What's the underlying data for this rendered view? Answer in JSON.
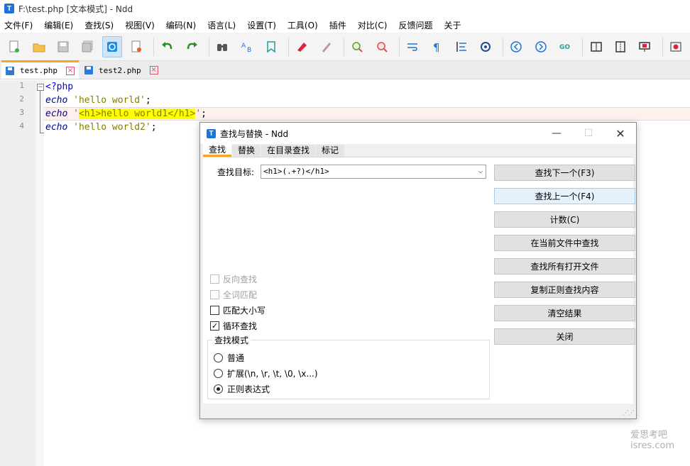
{
  "window": {
    "title": "F:\\test.php [文本模式] - Ndd",
    "icon": "T"
  },
  "menu": [
    "文件(F)",
    "编辑(E)",
    "查找(S)",
    "视图(V)",
    "编码(N)",
    "语言(L)",
    "设置(T)",
    "工具(O)",
    "插件",
    "对比(C)",
    "反馈问题",
    "关于"
  ],
  "tabs": [
    {
      "label": "test.php",
      "active": true
    },
    {
      "label": "test2.php",
      "active": false
    }
  ],
  "editor": {
    "line_numbers": [
      "1",
      "2",
      "3",
      "4"
    ],
    "line1": {
      "open": "<?php"
    },
    "line2": {
      "kw": "echo",
      "sp": " ",
      "str": "'hello world'",
      "end": ";"
    },
    "line3": {
      "kw": "echo",
      "sp": " ",
      "q1": "'",
      "hl": "<h1>hello world1</h1>",
      "q2": "'",
      "end": ";"
    },
    "line4": {
      "kw": "echo",
      "sp": " ",
      "str": "'hello world2'",
      "end": ";"
    }
  },
  "dialog": {
    "title": "查找与替换 - Ndd",
    "tabs": [
      "查找",
      "替换",
      "在目录查找",
      "标记"
    ],
    "target_label": "查找目标:",
    "target_value": "<h1>(.+?)</h1>",
    "options": {
      "reverse": {
        "label": "反向查找",
        "checked": false,
        "enabled": false
      },
      "whole_word": {
        "label": "全词匹配",
        "checked": false,
        "enabled": false
      },
      "match_case": {
        "label": "匹配大小写",
        "checked": false,
        "enabled": true
      },
      "wrap": {
        "label": "循环查找",
        "checked": true,
        "enabled": true
      }
    },
    "mode": {
      "legend": "查找模式",
      "normal": "普通",
      "extended": "扩展(\\n, \\r, \\t, \\0, \\x...)",
      "regex": "正则表达式",
      "selected": "regex"
    },
    "buttons": {
      "find_next": "查找下一个(F3)",
      "find_prev": "查找上一个(F4)",
      "count": "计数(C)",
      "find_in_current": "在当前文件中查找",
      "find_in_open": "查找所有打开文件",
      "copy_regex": "复制正则查找内容",
      "clear": "清空结果",
      "close": "关闭"
    }
  },
  "watermark": {
    "line1": "爱思考吧",
    "line2": "isres.com"
  }
}
